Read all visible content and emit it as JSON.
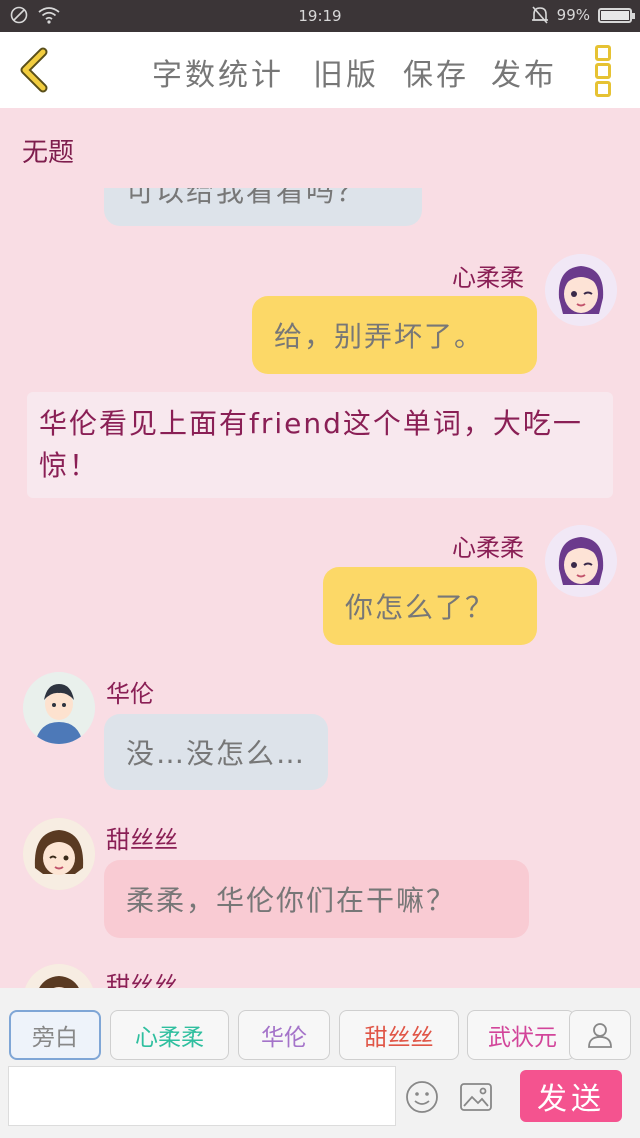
{
  "status": {
    "time": "19:19",
    "battery": "99%",
    "battery_level": 0.99
  },
  "toolbar": {
    "word_count": "字数统计",
    "old_version": "旧版",
    "save": "保存",
    "publish": "发布"
  },
  "story": {
    "title": "无题"
  },
  "messages": [
    {
      "type": "partner",
      "text": "可以给我看看吗？"
    },
    {
      "type": "self",
      "speaker": "心柔柔",
      "text": "给，别弄坏了。"
    },
    {
      "type": "narration",
      "text": "华伦看见上面有friend这个单词，大吃一惊！"
    },
    {
      "type": "self",
      "speaker": "心柔柔",
      "text": "你怎么了？"
    },
    {
      "type": "partner",
      "speaker": "华伦",
      "text": "没…没怎么…"
    },
    {
      "type": "partner",
      "speaker": "甜丝丝",
      "text": "柔柔，华伦你们在干嘛？"
    },
    {
      "type": "partner",
      "speaker": "甜丝丝"
    }
  ],
  "characters": [
    {
      "label": "旁白",
      "color": "#888888"
    },
    {
      "label": "心柔柔",
      "color": "#2fbf9f"
    },
    {
      "label": "华伦",
      "color": "#a473c9"
    },
    {
      "label": "甜丝丝",
      "color": "#e05546"
    },
    {
      "label": "武状元",
      "color": "#d2459a"
    }
  ],
  "composer": {
    "placeholder": "",
    "send_label": "发送"
  },
  "colors": {
    "accent": "#f4538f",
    "self_bubble": "#fcd867",
    "partner_bubble": "#dde3ea",
    "pink_bubble": "#f9cbd3",
    "speaker_name": "#8a1f55"
  }
}
